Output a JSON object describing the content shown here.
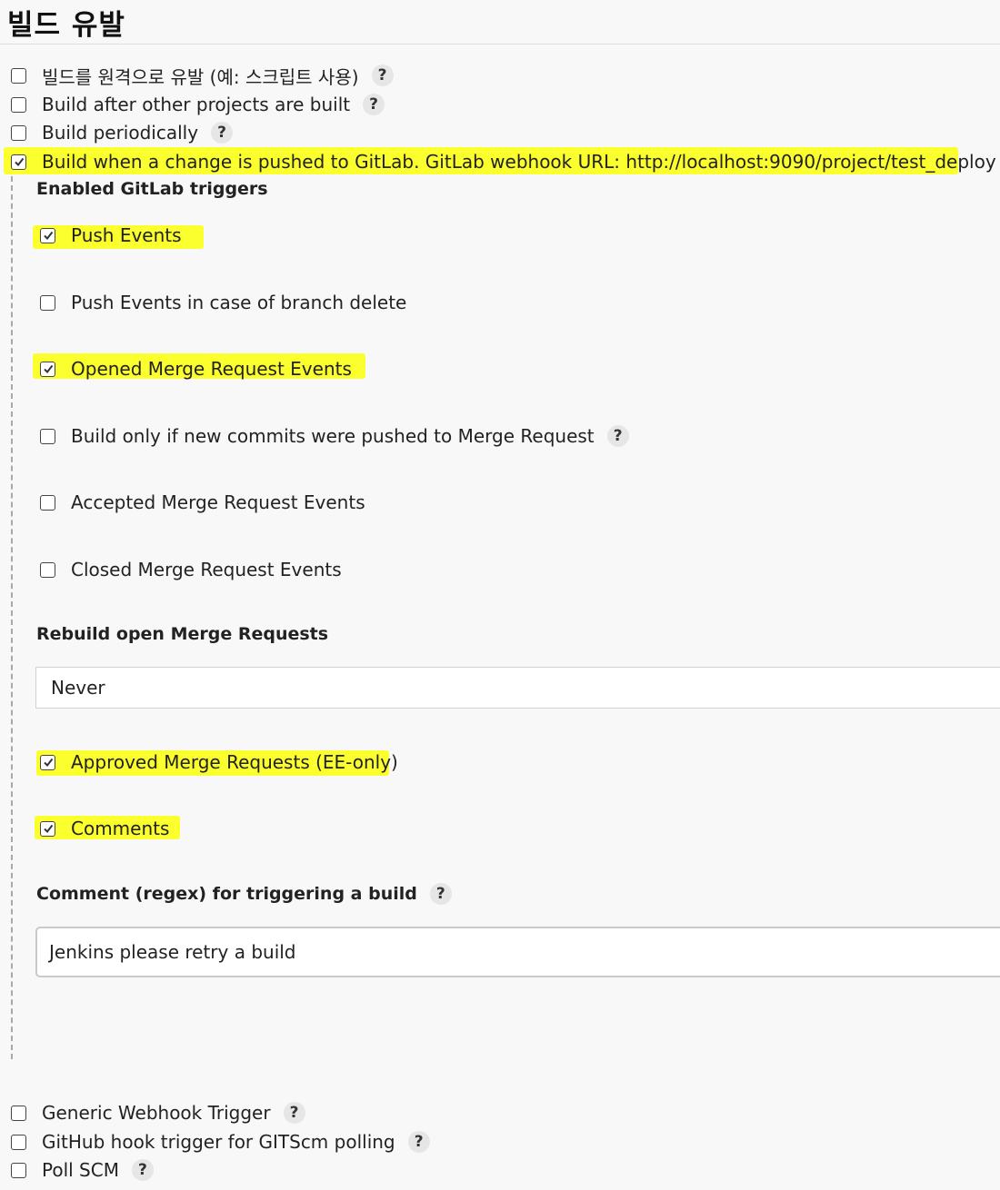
{
  "section": {
    "title": "빌드 유발"
  },
  "triggers": [
    {
      "label": "빌드를 원격으로 유발 (예: 스크립트 사용)",
      "checked": false
    },
    {
      "label": "Build after other projects are built",
      "checked": false
    },
    {
      "label": "Build periodically",
      "checked": false
    },
    {
      "label": "Build when a change is pushed to GitLab. GitLab webhook URL: http://localhost:9090/project/test_deploy",
      "checked": true
    }
  ],
  "gitlab": {
    "enabled_triggers_heading": "Enabled GitLab triggers",
    "options": [
      {
        "label": "Push Events",
        "checked": true
      },
      {
        "label": "Push Events in case of branch delete",
        "checked": false
      },
      {
        "label": "Opened Merge Request Events",
        "checked": true
      },
      {
        "label": "Build only if new commits were pushed to Merge Request",
        "checked": false
      },
      {
        "label": "Accepted Merge Request Events",
        "checked": false
      },
      {
        "label": "Closed Merge Request Events",
        "checked": false
      }
    ],
    "rebuild_heading": "Rebuild open Merge Requests",
    "rebuild_value": "Never",
    "approved": {
      "label": "Approved Merge Requests (EE-only)",
      "checked": true
    },
    "comments": {
      "label": "Comments",
      "checked": true
    },
    "comment_regex_heading": "Comment (regex) for triggering a build",
    "comment_regex_value": "Jenkins please retry a build"
  },
  "other_triggers": [
    {
      "label": "Generic Webhook Trigger",
      "checked": false
    },
    {
      "label": "GitHub hook trigger for GITScm polling",
      "checked": false
    },
    {
      "label": "Poll SCM",
      "checked": false
    }
  ],
  "help_label": "?",
  "colors": {
    "highlight": "#fbff2e",
    "background": "#f8f8f8"
  }
}
